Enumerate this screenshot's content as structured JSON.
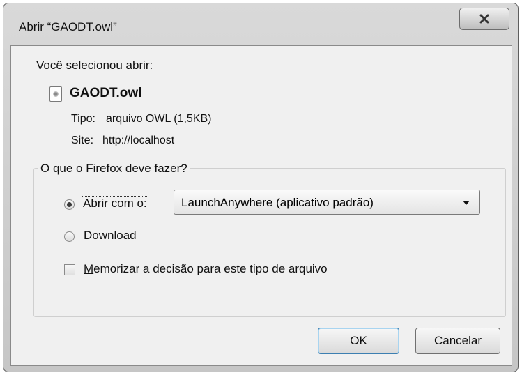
{
  "window": {
    "title": "Abrir “GAODT.owl”",
    "close_label": "X"
  },
  "dialog": {
    "prompt": "Você selecionou abrir:",
    "file_name": "GAODT.owl",
    "type_label": "Tipo:",
    "type_value": "arquivo OWL (1,5KB)",
    "site_label": "Site:",
    "site_value": "http://localhost"
  },
  "action_group": {
    "title": "O que o Firefox deve fazer?",
    "open_with": {
      "label_accel": "A",
      "label_rest": "brir com o:",
      "checked": true
    },
    "application_select": {
      "value": "LaunchAnywhere (aplicativo padrão)"
    },
    "download": {
      "label_accel": "D",
      "label_rest": "ownload",
      "checked": false
    },
    "remember": {
      "label_accel": "M",
      "label_rest": "emorizar a decisão para este tipo de arquivo",
      "checked": false
    }
  },
  "buttons": {
    "ok": "OK",
    "cancel": "Cancelar"
  },
  "icons": {
    "file": "file-icon",
    "close": "close-icon",
    "dropdown": "chevron-down-icon"
  }
}
